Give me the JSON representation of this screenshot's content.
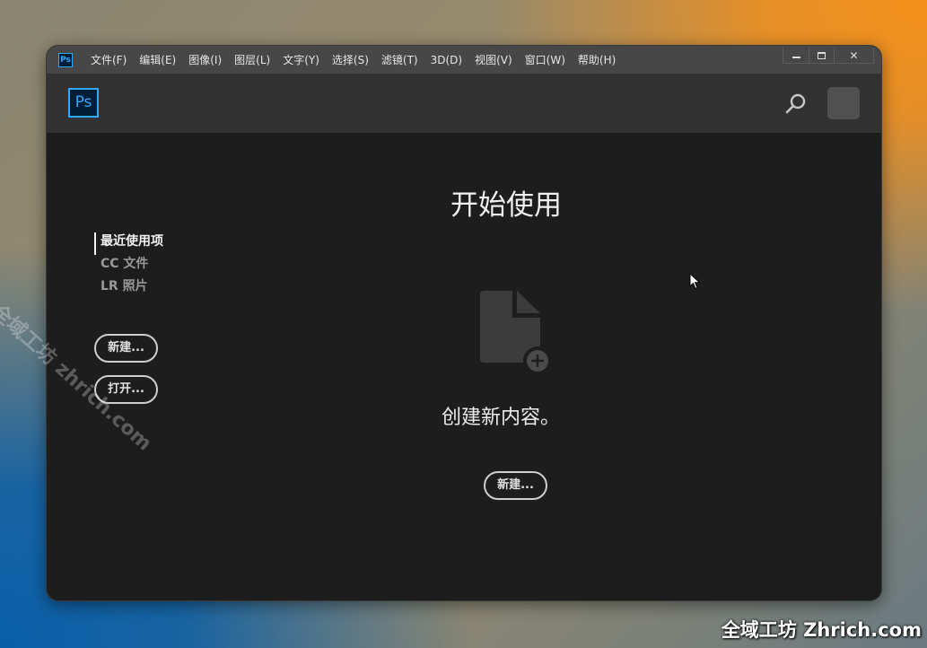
{
  "menubar": {
    "app_icon": "Ps",
    "items": [
      "文件(F)",
      "编辑(E)",
      "图像(I)",
      "图层(L)",
      "文字(Y)",
      "选择(S)",
      "滤镜(T)",
      "3D(D)",
      "视图(V)",
      "窗口(W)",
      "帮助(H)"
    ]
  },
  "window_controls": {
    "minimize": "minimize-icon",
    "maximize": "maximize-icon",
    "close": "✕"
  },
  "header": {
    "logo": "Ps",
    "search_icon": "search-icon"
  },
  "sidebar": {
    "nav": [
      "最近使用项",
      "CC 文件",
      "LR 照片"
    ],
    "new_label": "新建...",
    "open_label": "打开..."
  },
  "main": {
    "title": "开始使用",
    "create_text": "创建新内容。",
    "new_label": "新建..."
  },
  "watermark": {
    "bottom_right": "全域工坊 Zhrich.com",
    "diagonal": "全域工坊 zhrich.com"
  },
  "colors": {
    "accent": "#31a8ff",
    "menubar": "#474747",
    "header": "#323232",
    "body": "#1d1d1d"
  }
}
